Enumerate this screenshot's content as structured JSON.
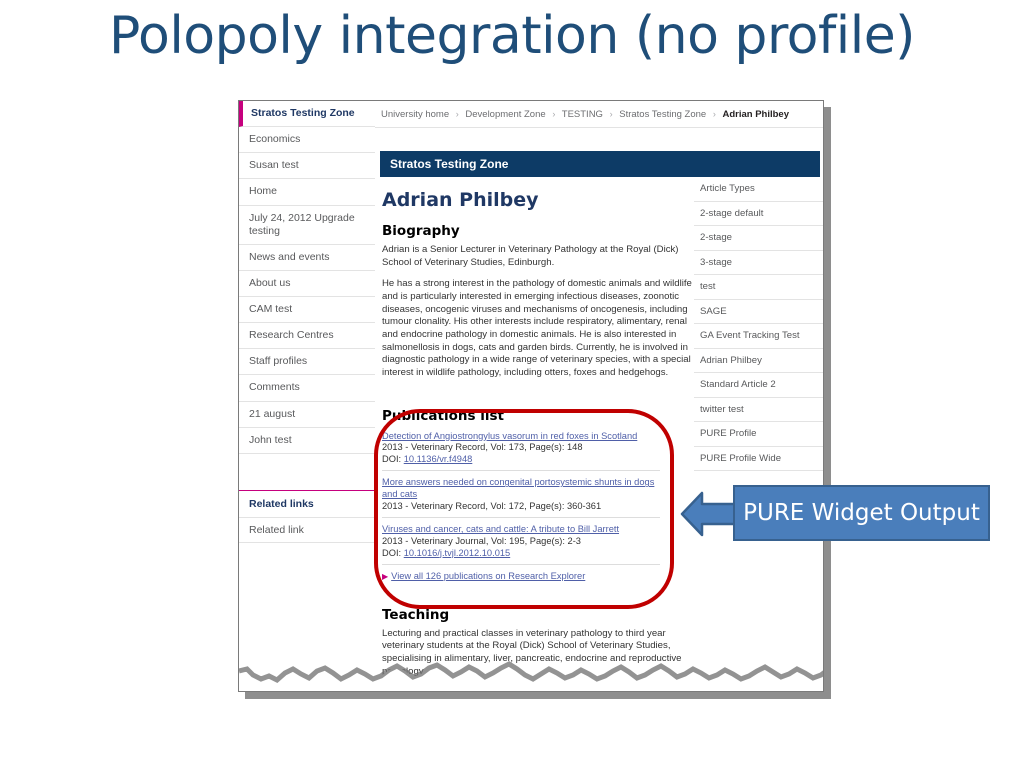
{
  "slide": {
    "title": "Polopoly integration (no profile)",
    "title_color": "#1F4E79"
  },
  "sidebar": {
    "items": [
      {
        "label": "Stratos Testing Zone",
        "active": true
      },
      {
        "label": "Economics"
      },
      {
        "label": "Susan test"
      },
      {
        "label": "Home"
      },
      {
        "label": "July 24, 2012 Upgrade testing"
      },
      {
        "label": "News and events"
      },
      {
        "label": "About us"
      },
      {
        "label": "CAM test"
      },
      {
        "label": "Research Centres"
      },
      {
        "label": "Staff profiles"
      },
      {
        "label": "Comments"
      },
      {
        "label": "21 august"
      },
      {
        "label": "John test"
      }
    ],
    "related": {
      "title": "Related links",
      "link": "Related link"
    },
    "accent_color": "#c6007e"
  },
  "breadcrumb": {
    "items": [
      "University home",
      "Development Zone",
      "TESTING",
      "Stratos Testing Zone"
    ],
    "current": "Adrian Philbey",
    "separator": "›"
  },
  "banner": {
    "label": "Stratos Testing Zone",
    "background": "#0d3b66"
  },
  "profile": {
    "name": "Adrian Philbey",
    "biography_heading": "Biography",
    "biography_paragraphs": [
      "Adrian is a Senior Lecturer in Veterinary Pathology at the Royal (Dick) School of Veterinary Studies, Edinburgh.",
      "He has a strong interest in the pathology of domestic animals and wildlife and is particularly interested in emerging infectious diseases, zoonotic diseases, oncogenic viruses and mechanisms of oncogenesis, including tumour clonality. His other interests include respiratory, alimentary, renal and endocrine pathology in domestic animals. He is also interested in salmonellosis in dogs, cats and garden birds. Currently, he is involved in diagnostic pathology in a wide range of veterinary species, with a special interest in wildlife pathology, including otters, foxes and hedgehogs."
    ],
    "teaching_heading": "Teaching",
    "teaching_text": "Lecturing and practical classes in veterinary pathology to third year veterinary students at the Royal (Dick) School of Veterinary Studies, specialising in alimentary, liver, pancreatic, endocrine and reproductive pathology."
  },
  "publications": {
    "heading": "Publications list",
    "entries": [
      {
        "title": "Detection of Angiostrongylus vasorum in red foxes in Scotland",
        "meta": "2013 - Veterinary Record, Vol: 173, Page(s): 148",
        "doi_label": "DOI:",
        "doi": "10.1136/vr.f4948"
      },
      {
        "title": "More answers needed on congenital portosystemic shunts in dogs and cats",
        "meta": "2013 - Veterinary Record, Vol: 172, Page(s): 360-361",
        "doi_label": "",
        "doi": ""
      },
      {
        "title": "Viruses and cancer, cats and cattle: A tribute to Bill Jarrett",
        "meta": "2013 - Veterinary Journal, Vol: 195, Page(s): 2-3",
        "doi_label": "DOI:",
        "doi": "10.1016/j.tvjl.2012.10.015"
      }
    ],
    "view_all": "View all 126 publications on Research Explorer",
    "highlight_color": "#c00000"
  },
  "right_rail": {
    "items": [
      "Article Types",
      "2-stage default",
      "2-stage",
      "3-stage",
      "test",
      "SAGE",
      "GA Event Tracking Test",
      "Adrian Philbey",
      "Standard Article 2",
      "twitter test",
      "PURE Profile",
      "PURE Profile Wide"
    ]
  },
  "callout": {
    "label": "PURE Widget Output",
    "fill": "#4a7ebb",
    "border": "#37618f",
    "arrow_direction": "left"
  }
}
